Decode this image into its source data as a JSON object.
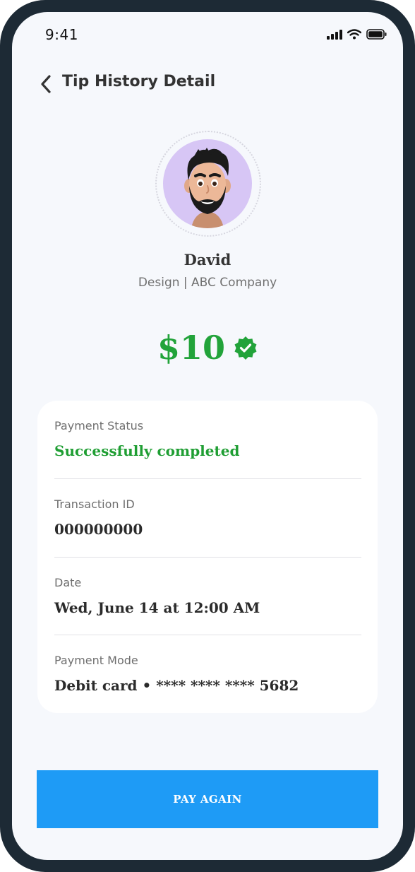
{
  "status_bar": {
    "time": "9:41"
  },
  "header": {
    "title": "Tip History Detail"
  },
  "profile": {
    "name": "David",
    "subtitle": "Design | ABC Company"
  },
  "tip": {
    "amount": "$10",
    "verified_icon": "verified-badge-icon"
  },
  "details": [
    {
      "label": "Payment Status",
      "value": "Successfully completed"
    },
    {
      "label": "Transaction ID",
      "value": "000000000"
    },
    {
      "label": "Date",
      "value": "Wed, June 14 at 12:00 AM"
    },
    {
      "label": "Payment Mode",
      "value": "Debit card • **** **** **** 5682"
    }
  ],
  "actions": {
    "pay_again": "PAY AGAIN"
  },
  "colors": {
    "accent": "#1e9bf6",
    "success": "#22a33a",
    "avatar_bg": "#d7c6f5",
    "frame": "#1d2a35",
    "background": "#f6f8fc"
  }
}
